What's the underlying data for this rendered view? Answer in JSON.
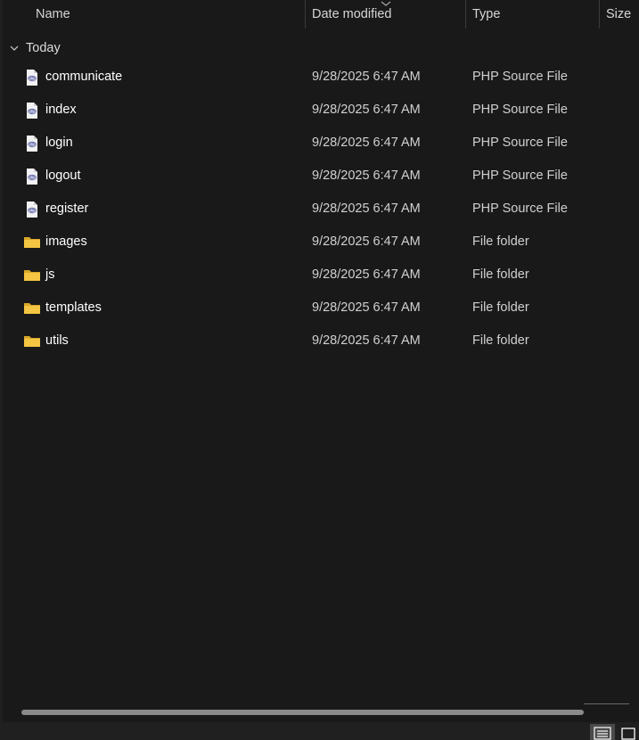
{
  "header": {
    "columns": [
      {
        "label": "Name"
      },
      {
        "label": "Date modified"
      },
      {
        "label": "Type"
      },
      {
        "label": "Size"
      }
    ]
  },
  "group": {
    "label": "Today"
  },
  "files": [
    {
      "name": "communicate",
      "date": "9/28/2025 6:47 AM",
      "type": "PHP Source File",
      "icon": "php-file-icon"
    },
    {
      "name": "index",
      "date": "9/28/2025 6:47 AM",
      "type": "PHP Source File",
      "icon": "php-file-icon"
    },
    {
      "name": "login",
      "date": "9/28/2025 6:47 AM",
      "type": "PHP Source File",
      "icon": "php-file-icon"
    },
    {
      "name": "logout",
      "date": "9/28/2025 6:47 AM",
      "type": "PHP Source File",
      "icon": "php-file-icon"
    },
    {
      "name": "register",
      "date": "9/28/2025 6:47 AM",
      "type": "PHP Source File",
      "icon": "php-file-icon"
    },
    {
      "name": "images",
      "date": "9/28/2025 6:47 AM",
      "type": "File folder",
      "icon": "folder-icon"
    },
    {
      "name": "js",
      "date": "9/28/2025 6:47 AM",
      "type": "File folder",
      "icon": "folder-icon"
    },
    {
      "name": "templates",
      "date": "9/28/2025 6:47 AM",
      "type": "File folder",
      "icon": "folder-icon"
    },
    {
      "name": "utils",
      "date": "9/28/2025 6:47 AM",
      "type": "File folder",
      "icon": "folder-icon"
    }
  ],
  "colors": {
    "background": "#191919",
    "text": "#ffffff",
    "secondary_text": "#d0d0d0",
    "folder_yellow": "#f4c542",
    "php_purple": "#7b7fb5"
  },
  "view_buttons": [
    {
      "icon": "details-view-icon",
      "selected": true
    },
    {
      "icon": "tiles-view-icon",
      "selected": false
    }
  ]
}
